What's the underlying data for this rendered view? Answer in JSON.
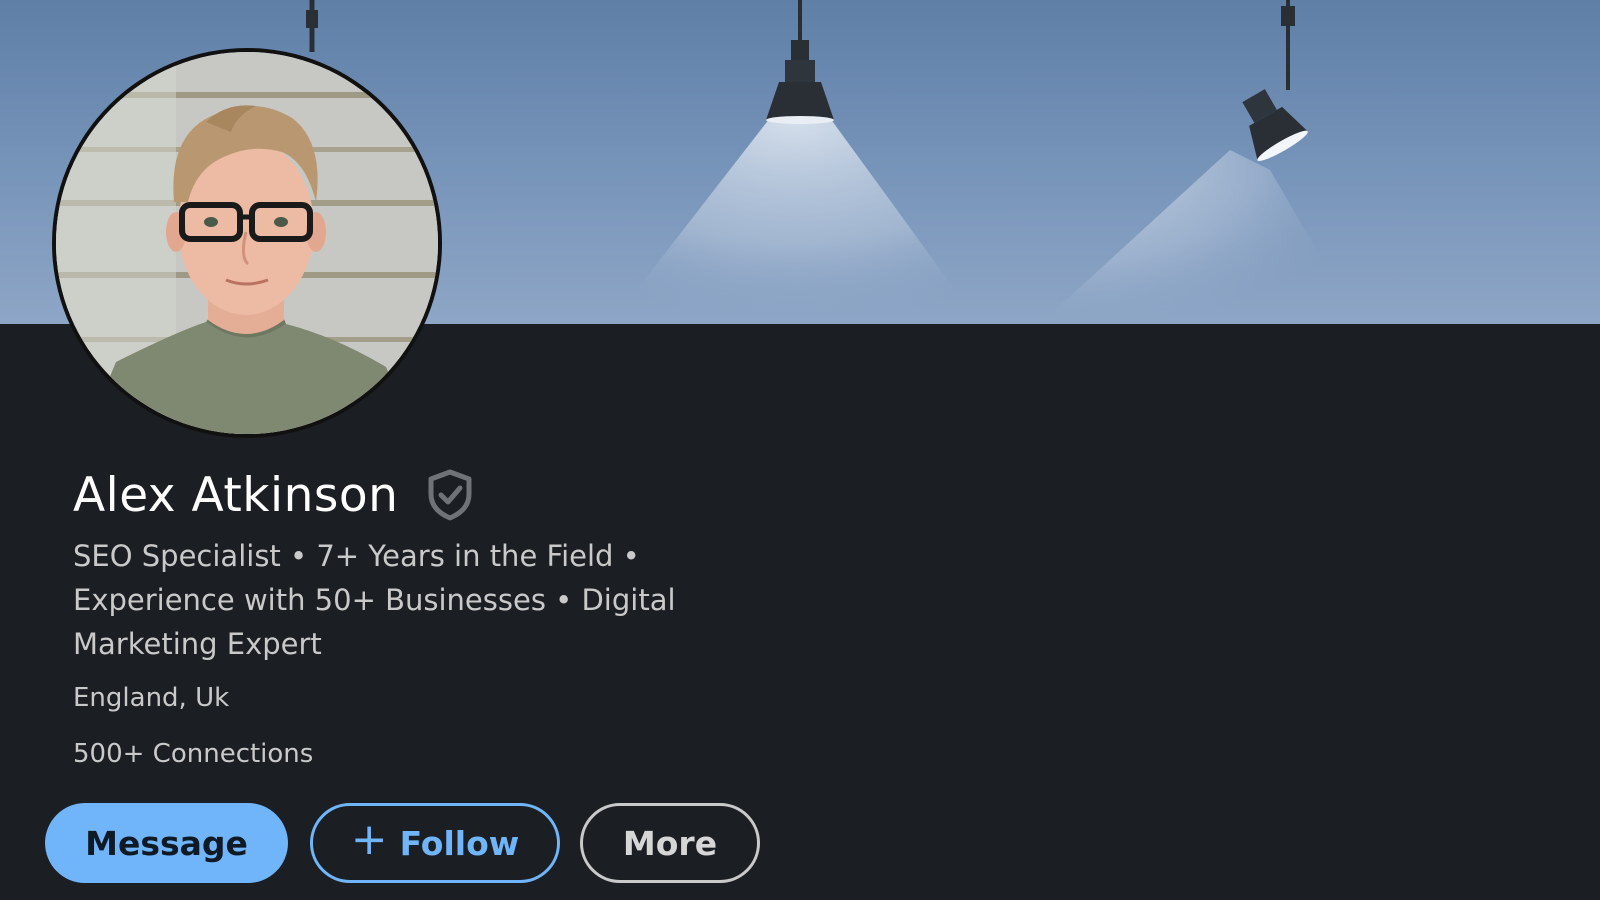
{
  "profile": {
    "name": "Alex Atkinson",
    "verified_icon": "shield-check-icon",
    "headline": "SEO Specialist • 7+ Years in the Field • Experience with 50+ Businesses • Digital Marketing Expert",
    "location": "England, Uk",
    "connections": "500+ Connections"
  },
  "actions": {
    "message_label": "Message",
    "follow_label": "Follow",
    "follow_icon": "plus-icon",
    "more_label": "More"
  },
  "colors": {
    "accent": "#70b5f9",
    "background": "#1b1f23",
    "text_primary": "#ffffff",
    "text_secondary": "#c9c9c9"
  }
}
